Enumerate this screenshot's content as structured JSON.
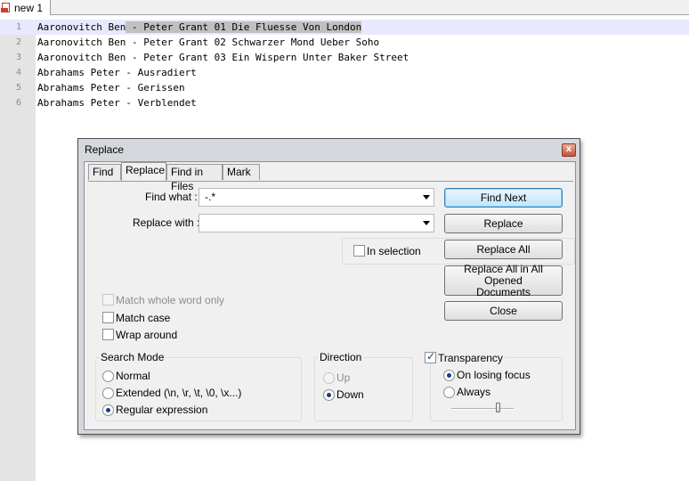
{
  "editor": {
    "tab_label": "new 1",
    "lines": [
      {
        "num": "1",
        "pre": "Aaronovitch Ben",
        "sel": " - Peter Grant 01 Die Fluesse Von London"
      },
      {
        "num": "2",
        "pre": "Aaronovitch Ben - Peter Grant 02 Schwarzer Mond Ueber Soho",
        "sel": ""
      },
      {
        "num": "3",
        "pre": "Aaronovitch Ben - Peter Grant 03 Ein Wispern Unter Baker Street",
        "sel": ""
      },
      {
        "num": "4",
        "pre": "Abrahams Peter - Ausradiert",
        "sel": ""
      },
      {
        "num": "5",
        "pre": "Abrahams Peter - Gerissen",
        "sel": ""
      },
      {
        "num": "6",
        "pre": "Abrahams Peter - Verblendet",
        "sel": ""
      }
    ]
  },
  "dialog": {
    "title": "Replace",
    "close_label": "x",
    "tabs": [
      "Find",
      "Replace",
      "Find in Files",
      "Mark"
    ],
    "active_tab": "Replace",
    "find_what_label": "Find what :",
    "find_what_value": "-.*",
    "replace_with_label": "Replace with :",
    "replace_with_value": "",
    "in_selection_label": "In selection",
    "buttons": {
      "find_next": "Find Next",
      "replace": "Replace",
      "replace_all": "Replace All",
      "replace_all_opened_line1": "Replace All in All Opened",
      "replace_all_opened_line2": "Documents",
      "close": "Close"
    },
    "options": {
      "match_whole_word": "Match whole word only",
      "match_case": "Match case",
      "wrap_around": "Wrap around"
    },
    "search_mode": {
      "title": "Search Mode",
      "normal": "Normal",
      "extended": "Extended (\\n, \\r, \\t, \\0, \\x...)",
      "regex": "Regular expression",
      "selected": "Regular expression"
    },
    "direction": {
      "title": "Direction",
      "up": "Up",
      "down": "Down",
      "selected": "Down"
    },
    "transparency": {
      "label": "Transparency",
      "checked": true,
      "on_losing_focus": "On losing focus",
      "always": "Always",
      "selected": "On losing focus",
      "slider_level": 0.75
    }
  },
  "colors": {
    "gutter": "#e4e4e4",
    "current_line": "#e8e8ff",
    "selection": "#c0c0c0",
    "dialog_bg": "#f0f0f0",
    "default_button": "#bee6fd"
  }
}
